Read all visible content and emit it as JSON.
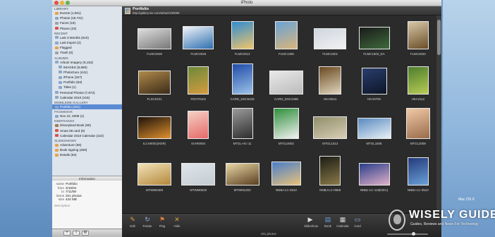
{
  "window": {
    "title": "iPhoto"
  },
  "sidebar": {
    "sections": [
      {
        "header": "LIBRARY",
        "items": [
          {
            "label": "Events (1,061)",
            "icon": "events-icon",
            "color": "orange",
            "depth": 1
          },
          {
            "label": "Photos (19,731)",
            "icon": "photos-icon",
            "color": "blue",
            "depth": 1
          },
          {
            "label": "Faces (19)",
            "icon": "faces-icon",
            "color": "grey",
            "depth": 1
          },
          {
            "label": "Places (23)",
            "icon": "places-icon",
            "color": "red",
            "depth": 1
          }
        ]
      },
      {
        "header": "RECENT",
        "items": [
          {
            "label": "Last 3 Months (510)",
            "icon": "calendar-icon",
            "color": "blue",
            "depth": 1
          },
          {
            "label": "Last Import (2)",
            "icon": "import-icon",
            "color": "blue",
            "depth": 1
          },
          {
            "label": "Flagged",
            "icon": "flag-icon",
            "color": "orange",
            "depth": 1
          },
          {
            "label": "Trash (0)",
            "icon": "trash-icon",
            "color": "grey",
            "depth": 1
          }
        ]
      },
      {
        "header": "ALBUMS",
        "items": [
          {
            "label": "Arbutz Imagery (8,153)",
            "icon": "folder-icon",
            "color": "blue",
            "depth": 1
          },
          {
            "label": "IMAGES (8,680)",
            "icon": "album-icon",
            "color": "blue",
            "depth": 2
          },
          {
            "label": "PhotoGuru (441)",
            "icon": "album-icon",
            "color": "blue",
            "depth": 2
          },
          {
            "label": "iPhone (327)",
            "icon": "album-icon",
            "color": "blue",
            "depth": 2
          },
          {
            "label": "Portfolio (83)",
            "icon": "album-icon",
            "color": "blue",
            "depth": 2
          },
          {
            "label": "Titles (1)",
            "icon": "album-icon",
            "color": "blue",
            "depth": 2
          },
          {
            "label": "Personal Photos (7,872)",
            "icon": "folder-icon",
            "color": "blue",
            "depth": 1
          },
          {
            "label": "Calendar 2010 (219)",
            "icon": "calendar-icon",
            "color": "blue",
            "depth": 1
          }
        ]
      },
      {
        "header": "MOBILEME GALLERY",
        "items": [
          {
            "label": "Portfolio (201)",
            "icon": "mobileme-icon",
            "color": "blue",
            "depth": 1,
            "selected": true
          }
        ]
      },
      {
        "header": "FACEBOOK",
        "items": [
          {
            "label": "Nov 10, 2009 (1)",
            "icon": "facebook-icon",
            "color": "blue",
            "depth": 1
          }
        ]
      },
      {
        "header": "KEEPSAKES",
        "items": [
          {
            "label": "Disneyland Book (90)",
            "icon": "book-icon",
            "color": "brown",
            "depth": 1
          },
          {
            "label": "Xmas 08 card (9)",
            "icon": "card-icon",
            "color": "red",
            "depth": 1
          },
          {
            "label": "Calendar 2010 Calendar (222)",
            "icon": "calendar-icon",
            "color": "red",
            "depth": 1
          }
        ]
      },
      {
        "header": "SLIDESHOWS",
        "items": [
          {
            "label": "Adventure (59)",
            "icon": "slideshow-icon",
            "color": "orange",
            "depth": 1
          },
          {
            "label": "Book signing (469)",
            "icon": "slideshow-icon",
            "color": "orange",
            "depth": 1
          },
          {
            "label": "Details (63)",
            "icon": "slideshow-icon",
            "color": "orange",
            "depth": 1
          }
        ]
      }
    ]
  },
  "information": {
    "header": "Information",
    "rows": [
      {
        "key": "name",
        "value": "Portfolio"
      },
      {
        "key": "from",
        "value": "3/18/04"
      },
      {
        "key": "to",
        "value": "7/11/08"
      },
      {
        "key": "items",
        "value": "201 photos"
      },
      {
        "key": "size",
        "value": "434 MB"
      }
    ],
    "description": "description"
  },
  "sidebar_footer": {
    "buttons": [
      "+",
      "i",
      "gear"
    ]
  },
  "breadcrumb": {
    "title": "Portfolio",
    "url": "http://gallery.me.com/arbutz/100008"
  },
  "photos": [
    {
      "caption": "FLMC0028",
      "colors": [
        "#ddd",
        "#777"
      ]
    },
    {
      "caption": "FLMC0025",
      "colors": [
        "#f0f4f8",
        "#2d6fb0"
      ]
    },
    {
      "caption": "FLMC0313",
      "colors": [
        "#2f8cd1",
        "#f1c56b"
      ]
    },
    {
      "caption": "FLMC1309",
      "colors": [
        "#6aa3d8",
        "#d8b47a"
      ]
    },
    {
      "caption": "FLMC3401",
      "colors": [
        "#cfd6df",
        "#f1f1f1"
      ]
    },
    {
      "caption": "FLMC1503_DA",
      "colors": [
        "#1a1a1a",
        "#3f6b3c"
      ]
    },
    {
      "caption": "FLMC2620",
      "colors": [
        "#d6c7a8",
        "#6b4e27"
      ]
    },
    {
      "caption": "FLSC0101",
      "colors": [
        "#b08a4a",
        "#3a2a18"
      ]
    },
    {
      "caption": "FDOT0101",
      "colors": [
        "#6d8a3a",
        "#d59b40"
      ]
    },
    {
      "caption": "CARD_DSC5433",
      "colors": [
        "#1f4ca8",
        "#9cc2e8"
      ]
    },
    {
      "caption": "CARD_DSC3468",
      "colors": [
        "#e9e9e9",
        "#bbb"
      ]
    },
    {
      "caption": "HKA0611",
      "colors": [
        "#6a4a22",
        "#e0d5bd"
      ]
    },
    {
      "caption": "HKA0700",
      "colors": [
        "#2a3e6e",
        "#0d1526"
      ]
    },
    {
      "caption": "HKA2112",
      "colors": [
        "#4e7d2e",
        "#b7cc54"
      ]
    },
    {
      "caption": "ILCH0001(HDR)",
      "colors": [
        "#1d130a",
        "#e0902e"
      ]
    },
    {
      "caption": "ISAR0004",
      "colors": [
        "#f4d0c4",
        "#e66a6a"
      ]
    },
    {
      "caption": "MTGL-HC-11",
      "colors": [
        "#9a9a9a",
        "#2e2e2e"
      ]
    },
    {
      "caption": "MTGL0002",
      "colors": [
        "#2e8f3a",
        "#f2f2f2"
      ]
    },
    {
      "caption": "MTGL1013",
      "colors": [
        "#8f8f6a",
        "#d9cdb6"
      ]
    },
    {
      "caption": "MTGL1505",
      "colors": [
        "#5a8ac0",
        "#e8f0f6"
      ]
    },
    {
      "caption": "MTGL2009",
      "colors": [
        "#f0c9a6",
        "#9a6b4a"
      ]
    },
    {
      "caption": "MTWM0408",
      "colors": [
        "#f1e2b8",
        "#b5883c"
      ]
    },
    {
      "caption": "MTWM0620",
      "colors": [
        "#dfe6ea",
        "#c3ccd2"
      ]
    },
    {
      "caption": "MTWM1203",
      "colors": [
        "#e9d7a6",
        "#5a3e1e"
      ]
    },
    {
      "caption": "NNBJ-LC-0510",
      "colors": [
        "#4a7ec8",
        "#e9c27a"
      ]
    },
    {
      "caption": "NNBJ-LC-0558",
      "colors": [
        "#1c1c14",
        "#8a7a4a"
      ]
    },
    {
      "caption": "NNBJ-LC-119(HDA)",
      "colors": [
        "#2a3f8a",
        "#e0b0c8"
      ]
    },
    {
      "caption": "NNBJ-LC-0510",
      "colors": [
        "#243a7a",
        "#6aa0d8"
      ]
    }
  ],
  "toolbar": {
    "left": [
      {
        "label": "Edit",
        "icon": "edit-icon"
      },
      {
        "label": "Rotate",
        "icon": "rotate-icon"
      },
      {
        "label": "Flag",
        "icon": "flag-icon"
      },
      {
        "label": "Hide",
        "icon": "hide-icon"
      }
    ],
    "right": [
      {
        "label": "Slideshow",
        "icon": "slideshow-play-icon"
      },
      {
        "label": "Book",
        "icon": "book-icon"
      },
      {
        "label": "Calendar",
        "icon": "calendar-icon"
      },
      {
        "label": "Card",
        "icon": "card-icon"
      }
    ],
    "photo_count": "201 photos",
    "zoom_level": 0.65
  },
  "watermark": {
    "name": "WISELY GUIDE",
    "tagline": "Guides, Reviews and News For Technology"
  },
  "desktop_label": "Mac OS X"
}
